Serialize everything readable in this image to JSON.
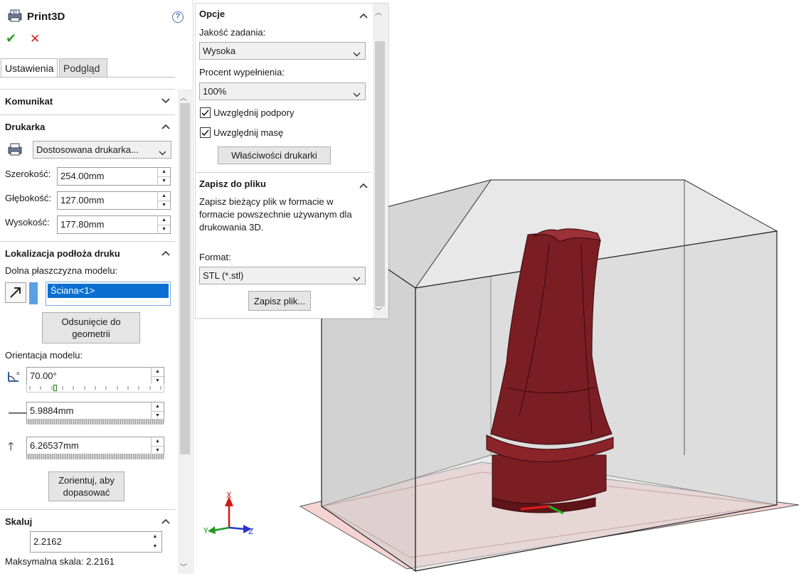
{
  "panel": {
    "title": "Print3D",
    "help_icon": "help-icon",
    "tabs": [
      "Ustawienia",
      "Podgląd"
    ],
    "sections": {
      "message": "Komunikat",
      "printer": "Drukarka",
      "bed_location": "Lokalizacja podłoża druku",
      "scale": "Skaluj"
    },
    "printer_select": "Dostosowana drukarka...",
    "width_label": "Szerokość:",
    "width_value": "254.00mm",
    "depth_label": "Głębokość:",
    "depth_value": "127.00mm",
    "height_label": "Wysokość:",
    "height_value": "177.80mm",
    "bottom_plane_label": "Dolna płaszczyzna modelu:",
    "face_selection": "Ściana<1>",
    "offset_button": [
      "Odsunięcie do",
      "geometrii"
    ],
    "orientation_label": "Orientacja modelu:",
    "rotation_value": "70.00°",
    "slider_fraction": 0.2,
    "x_offset_value": "5.9884mm",
    "y_offset_value": "6.26537mm",
    "fit_button": [
      "Zorientuj, aby",
      "dopasować"
    ],
    "scale_value": "2.2162",
    "max_scale_text": "Maksymalna skala: 2.2161"
  },
  "options": {
    "title": "Opcje",
    "quality_label": "Jakość zadania:",
    "quality_value": "Wysoka",
    "fill_label": "Procent wypełnienia:",
    "fill_value": "100%",
    "include_supports": "Uwzględnij podpory",
    "include_supports_checked": true,
    "include_mass": "Uwzględnij masę",
    "include_mass_checked": true,
    "printer_props_button": "Właściwości drukarki",
    "save_section": "Zapisz do pliku",
    "save_description": [
      "Zapisz bieżący plik w formacie w",
      "formacie powszechnie używanym dla",
      "drukowania 3D."
    ],
    "format_label": "Format:",
    "format_value": "STL (*.stl)",
    "save_button": "Zapisz plik..."
  },
  "viewport": {
    "triad": {
      "x": "X",
      "y": "Y",
      "z": "Z"
    },
    "model_color": "#7a1e24",
    "bed_color": "#f2c9c9",
    "box_color": "#d9d9d9"
  }
}
